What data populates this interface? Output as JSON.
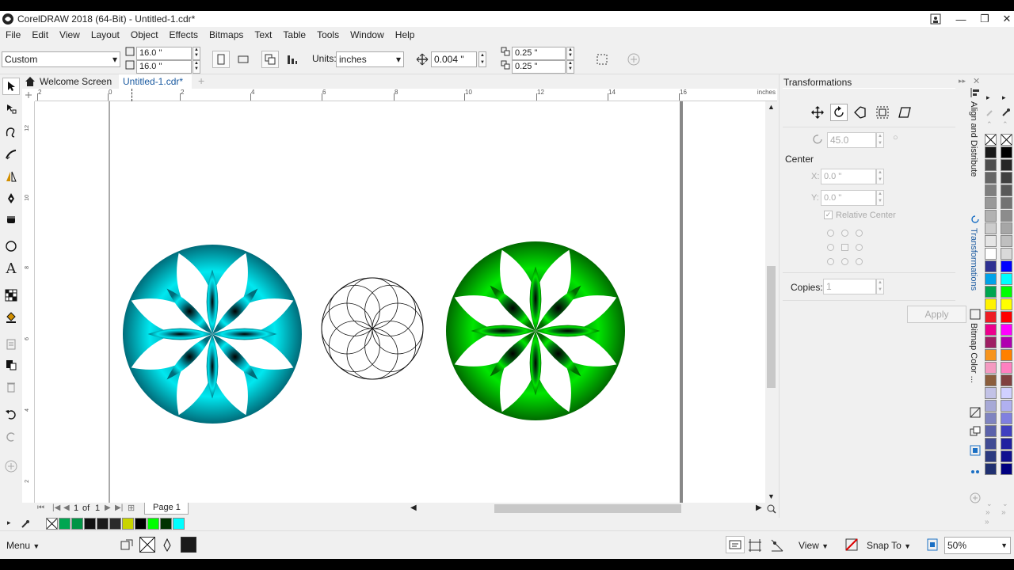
{
  "window": {
    "title": "CorelDRAW 2018 (64-Bit) - Untitled-1.cdr*"
  },
  "menu": [
    "File",
    "Edit",
    "View",
    "Layout",
    "Object",
    "Effects",
    "Bitmaps",
    "Text",
    "Table",
    "Tools",
    "Window",
    "Help"
  ],
  "propbar": {
    "page_size": "Custom",
    "width": "16.0 \"",
    "height": "16.0 \"",
    "units_label": "Units:",
    "units_value": "inches",
    "nudge": "0.004 \"",
    "dup_x": "0.25 \"",
    "dup_y": "0.25 \""
  },
  "tabs": {
    "welcome": "Welcome Screen",
    "doc": "Untitled-1.cdr*"
  },
  "ruler_h": {
    "labels": [
      "2",
      "0",
      "2",
      "4",
      "6",
      "8",
      "10",
      "12",
      "14",
      "16"
    ],
    "unit": "inches"
  },
  "ruler_v": {
    "labels": [
      "12",
      "10",
      "8",
      "6",
      "4",
      "2"
    ]
  },
  "pagenav": {
    "current": "1",
    "of": "of",
    "total": "1",
    "page_tab": "Page 1"
  },
  "docker": {
    "title": "Transformations",
    "angle": "45.0",
    "center_label": "Center",
    "x_label": "X:",
    "x_value": "0.0 \"",
    "y_label": "Y:",
    "y_value": "0.0 \"",
    "relative_center": "Relative Center",
    "copies_label": "Copies:",
    "copies_value": "1",
    "apply": "Apply"
  },
  "docker_tabs": [
    "Align and Distribute",
    "Transformations",
    "Bitmap Color ..."
  ],
  "palette": {
    "col1": [
      "#1a1a1a",
      "#4d4d4d",
      "#666666",
      "#7f7f7f",
      "#999999",
      "#b2b2b2",
      "#cccccc",
      "#e5e5e5",
      "#ffffff",
      "#2e3192",
      "#00a2e8",
      "#00a651",
      "#fff200",
      "#ed1c24",
      "#ec008c",
      "#9e1f63",
      "#f7941d",
      "#f49ac1",
      "#8b5e3c",
      "#c2c2e6",
      "#a7a9d6",
      "#7f84c0",
      "#5b62aa",
      "#404b94",
      "#2b3a80",
      "#203070"
    ],
    "col2": [
      "#000000",
      "#262626",
      "#404040",
      "#595959",
      "#737373",
      "#8c8c8c",
      "#a6a6a6",
      "#bfbfbf",
      "#d9d9d9",
      "#0000ff",
      "#00ffff",
      "#00ff00",
      "#ffff00",
      "#ff0000",
      "#ff00ff",
      "#b000b0",
      "#ff8000",
      "#ff80c0",
      "#804040",
      "#d0d0ff",
      "#b0b0f0",
      "#8080e0",
      "#4040c0",
      "#2020a0",
      "#101090",
      "#000080"
    ]
  },
  "doc_palette": [
    "#00a651",
    "#009444",
    "#111111",
    "#1a1a1a",
    "#2b2b2b",
    "#c8d400",
    "#000000",
    "#00ff00",
    "#003300",
    "#00ffff"
  ],
  "status": {
    "menu": "Menu",
    "view": "View",
    "snap": "Snap To",
    "zoom": "50%"
  }
}
